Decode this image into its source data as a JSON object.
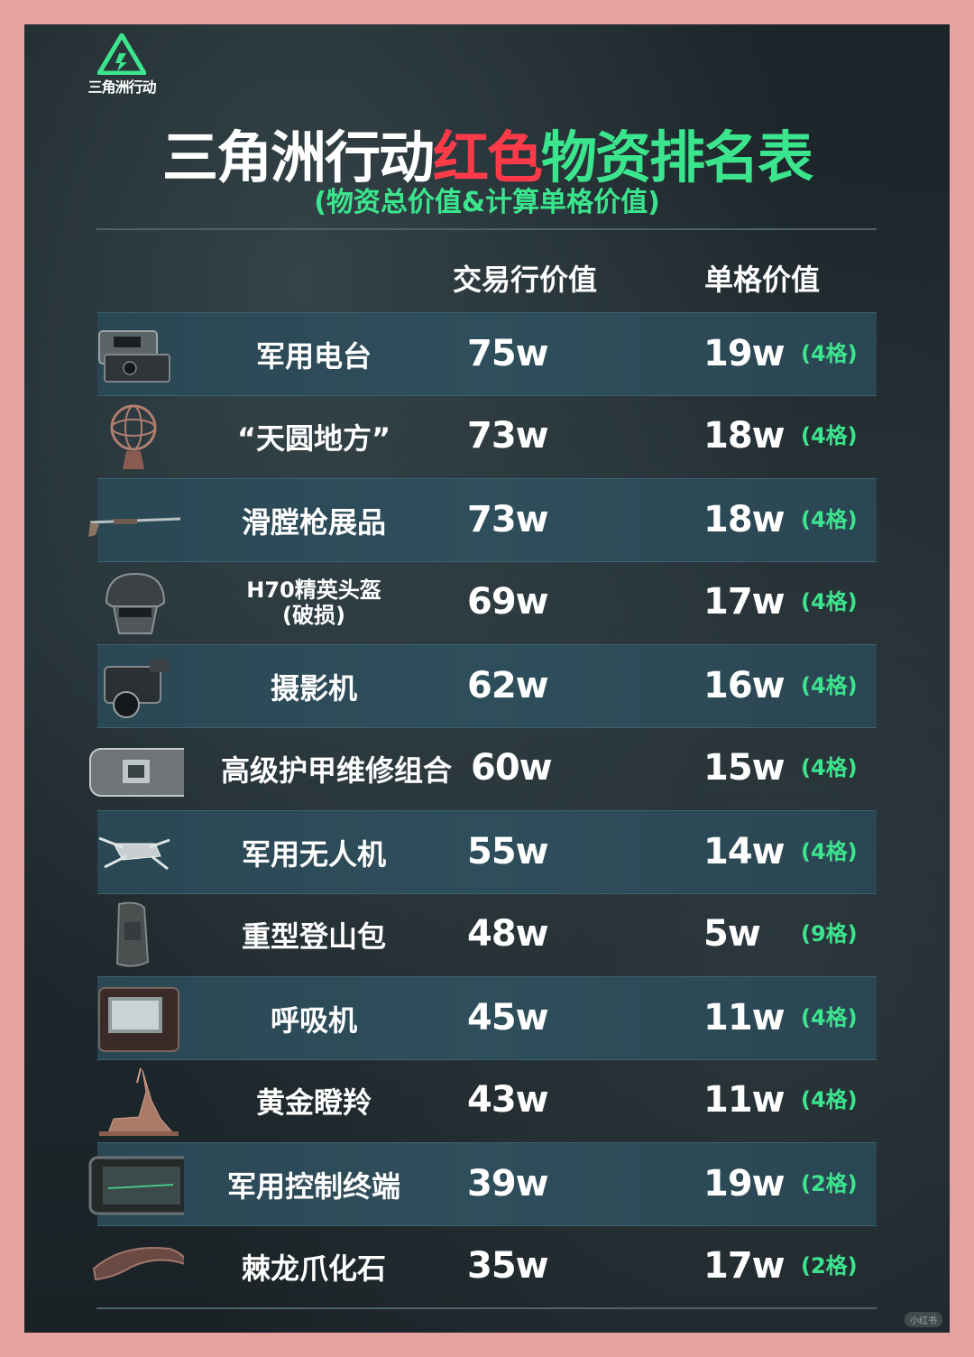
{
  "logo": {
    "text": "三角洲行动",
    "accent": "#3be58d"
  },
  "title": {
    "part1": "三角洲行动",
    "part2": "红色",
    "part3": "物资排名表"
  },
  "subtitle": "(物资总价值&计算单格价值)",
  "headers": {
    "trade_value": "交易行价值",
    "cell_value": "单格价值"
  },
  "colors": {
    "frame": "#e8a3a0",
    "red": "#ff3b4a",
    "green": "#3be58d",
    "stripe": "#2f4e5b"
  },
  "items": [
    {
      "name": "军用电台",
      "value": "75w",
      "cell_value": "19w",
      "slots": "(4格)",
      "icon": "radio-icon"
    },
    {
      "name": "“天圆地方”",
      "value": "73w",
      "cell_value": "18w",
      "slots": "(4格)",
      "icon": "armillary-sphere-icon"
    },
    {
      "name": "滑膛枪展品",
      "value": "73w",
      "cell_value": "18w",
      "slots": "(4格)",
      "icon": "musket-icon"
    },
    {
      "name": "H70精英头盔",
      "name2": "(破损)",
      "value": "69w",
      "cell_value": "17w",
      "slots": "(4格)",
      "icon": "helmet-icon"
    },
    {
      "name": "摄影机",
      "value": "62w",
      "cell_value": "16w",
      "slots": "(4格)",
      "icon": "camera-icon"
    },
    {
      "name": "高级护甲维修组合",
      "value": "60w",
      "cell_value": "15w",
      "slots": "(4格)",
      "icon": "armor-kit-icon"
    },
    {
      "name": "军用无人机",
      "value": "55w",
      "cell_value": "14w",
      "slots": "(4格)",
      "icon": "drone-icon"
    },
    {
      "name": "重型登山包",
      "value": "48w",
      "cell_value": "5w",
      "slots": "(9格)",
      "icon": "backpack-icon"
    },
    {
      "name": "呼吸机",
      "value": "45w",
      "cell_value": "11w",
      "slots": "(4格)",
      "icon": "ventilator-icon"
    },
    {
      "name": "黄金瞪羚",
      "value": "43w",
      "cell_value": "11w",
      "slots": "(4格)",
      "icon": "gazelle-icon"
    },
    {
      "name": "军用控制终端",
      "value": "39w",
      "cell_value": "19w",
      "slots": "(2格)",
      "icon": "terminal-icon"
    },
    {
      "name": "棘龙爪化石",
      "value": "35w",
      "cell_value": "17w",
      "slots": "(2格)",
      "icon": "claw-fossil-icon"
    }
  ],
  "watermark": "小红书"
}
